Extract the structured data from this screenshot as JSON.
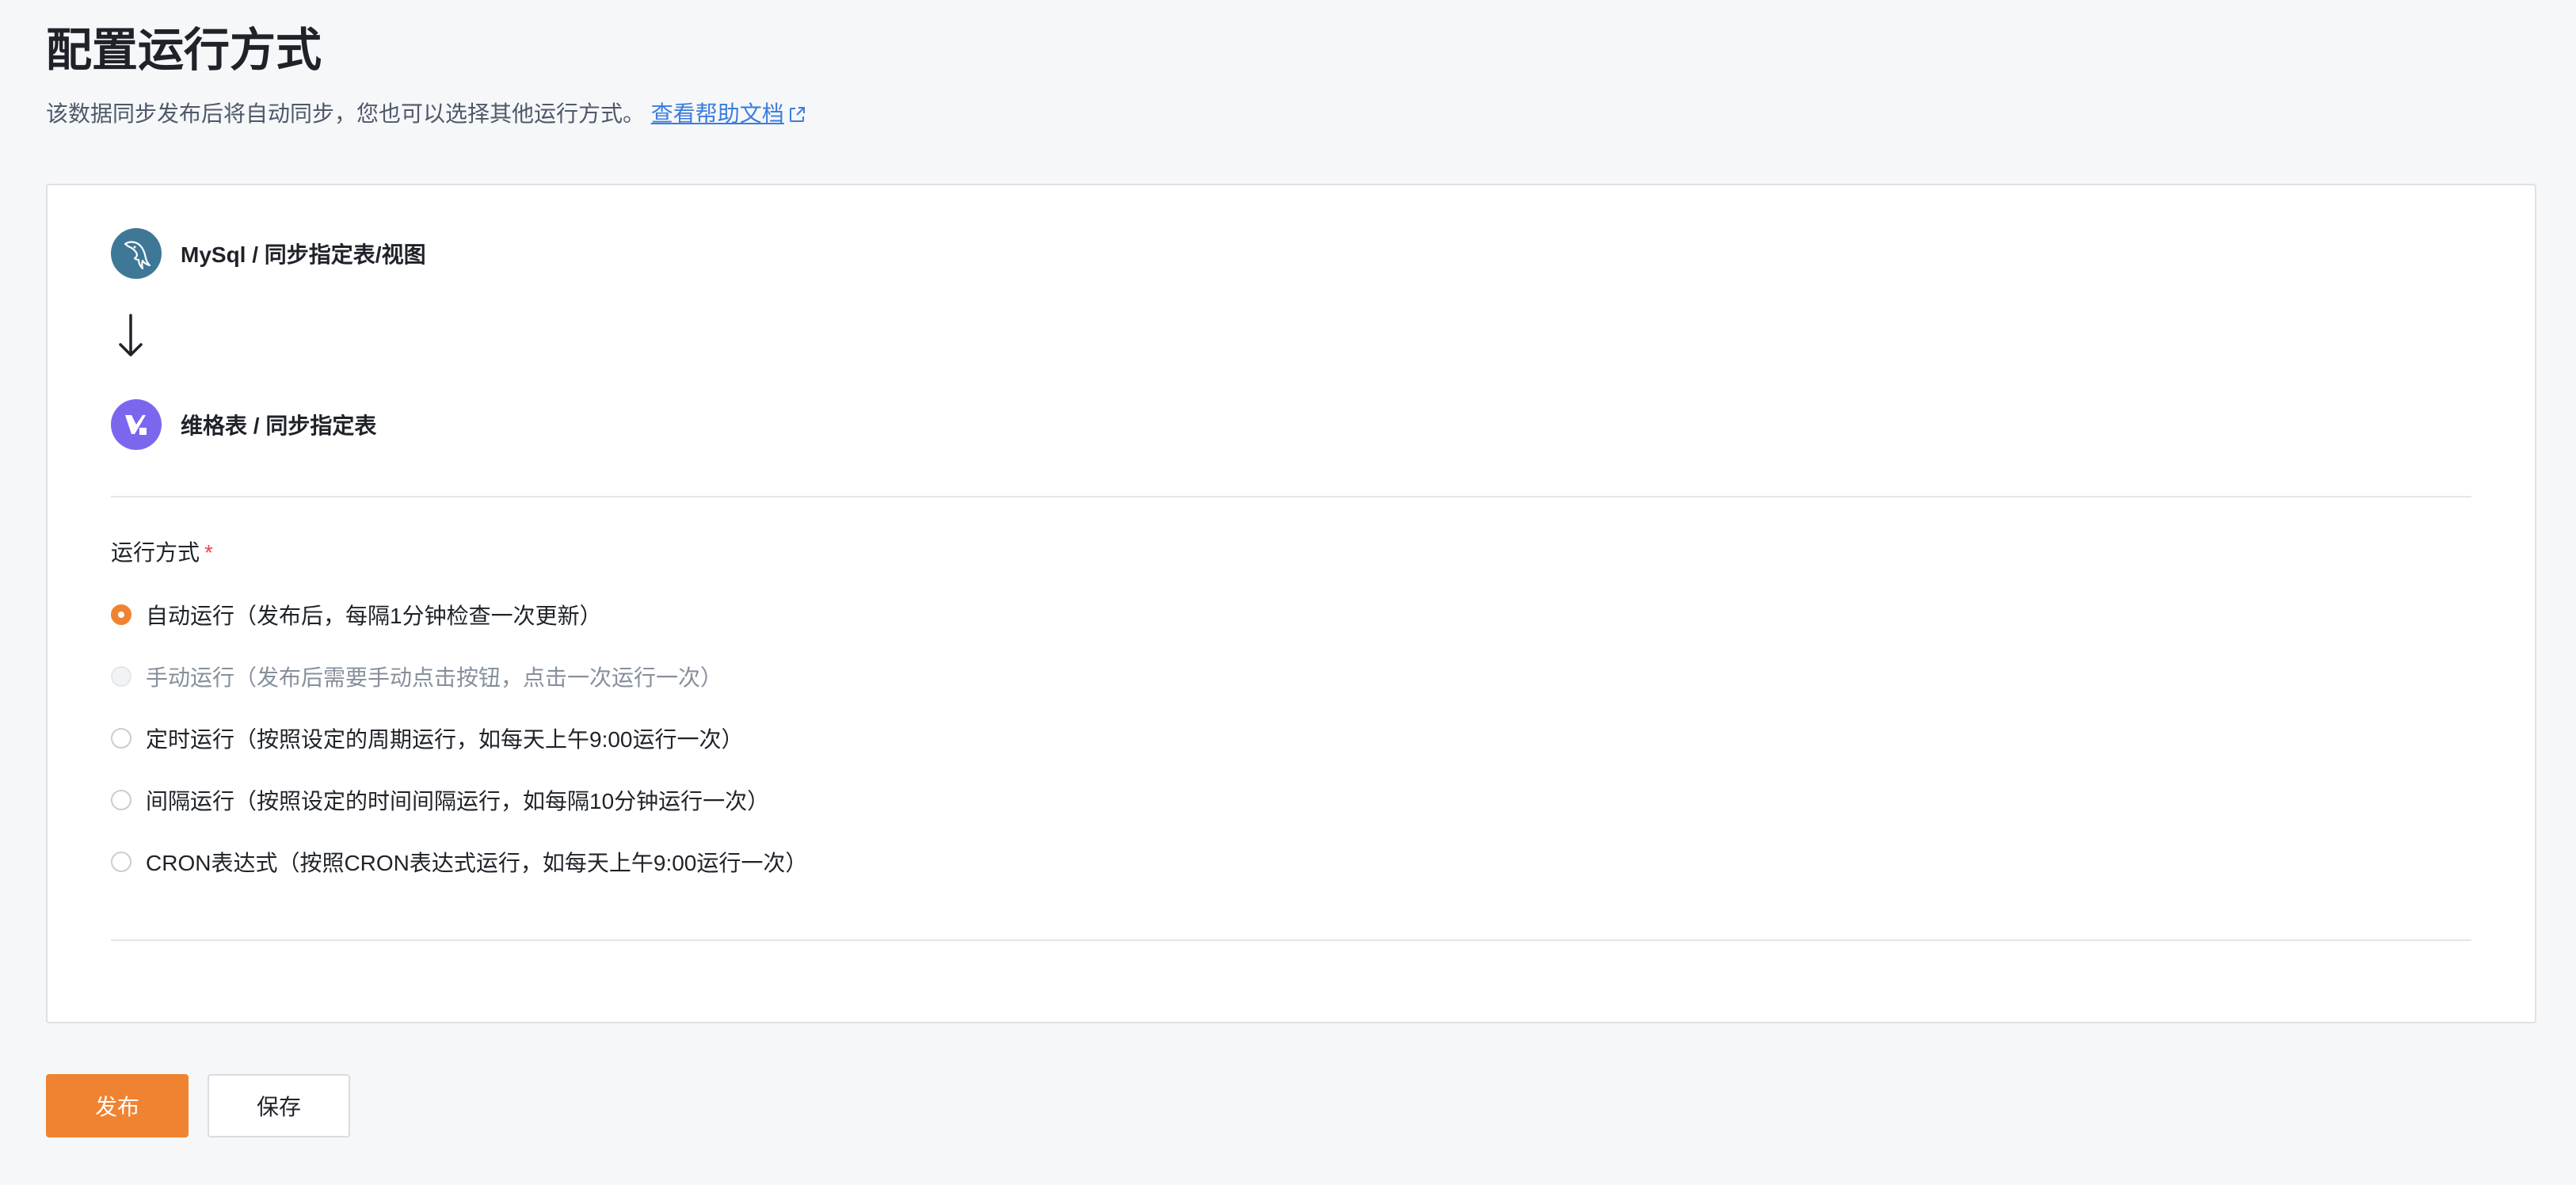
{
  "header": {
    "title": "配置运行方式",
    "description": "该数据同步发布后将自动同步，您也可以选择其他运行方式。",
    "help_link": "查看帮助文档"
  },
  "flow": {
    "source_label": "MySql / 同步指定表/视图",
    "source_icon": "mysql-logo-icon",
    "arrow_icon": "arrow-down-icon",
    "target_label": "维格表 / 同步指定表",
    "target_icon": "vika-logo-icon"
  },
  "run_mode": {
    "label": "运行方式",
    "required_mark": "*",
    "options": [
      {
        "label": "自动运行（发布后，每隔1分钟检查一次更新）",
        "checked": true,
        "disabled": false
      },
      {
        "label": "手动运行（发布后需要手动点击按钮，点击一次运行一次）",
        "checked": false,
        "disabled": true
      },
      {
        "label": "定时运行（按照设定的周期运行，如每天上午9:00运行一次）",
        "checked": false,
        "disabled": false
      },
      {
        "label": "间隔运行（按照设定的时间间隔运行，如每隔10分钟运行一次）",
        "checked": false,
        "disabled": false
      },
      {
        "label": "CRON表达式（按照CRON表达式运行，如每天上午9:00运行一次）",
        "checked": false,
        "disabled": false
      }
    ]
  },
  "actions": {
    "publish_label": "发布",
    "save_label": "保存"
  },
  "colors": {
    "accent": "#f08331",
    "link": "#3b7ddd",
    "mysql_brand": "#3e7896",
    "vika_brand": "#7b67ee"
  }
}
